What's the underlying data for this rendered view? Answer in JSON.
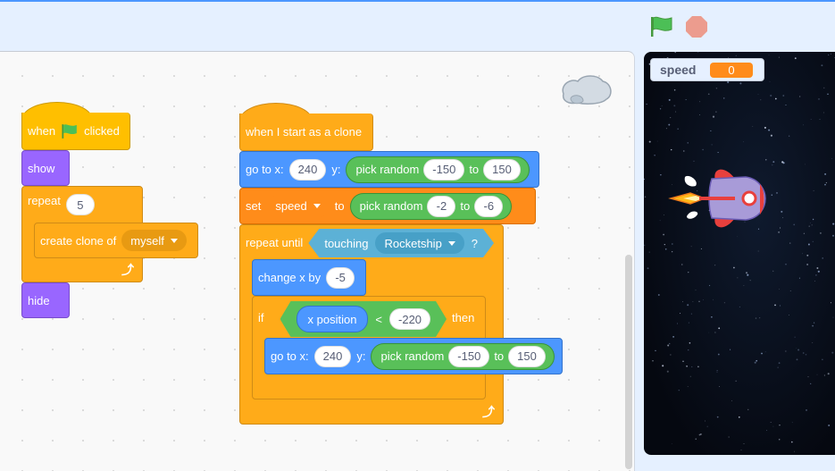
{
  "header": {
    "green_flag": "green-flag",
    "stop": "stop-sign"
  },
  "stage": {
    "monitor": {
      "label": "speed",
      "value": "0"
    },
    "sprite": "Rocketship"
  },
  "script1": {
    "hat": {
      "when": "when",
      "clicked": "clicked"
    },
    "show": "show",
    "repeat": {
      "label": "repeat",
      "count": "5"
    },
    "create_clone": {
      "label": "create clone of",
      "target": "myself"
    },
    "hide": "hide"
  },
  "script2": {
    "hat": "when I start as a clone",
    "goto1": {
      "label": "go to x:",
      "x": "240",
      "y_label": "y:",
      "pick": "pick random",
      "from": "-150",
      "to_label": "to",
      "to": "150"
    },
    "set": {
      "label": "set",
      "var": "speed",
      "to_label": "to",
      "pick": "pick random",
      "from": "-2",
      "to_sep": "to",
      "to": "-6"
    },
    "repeat_until": {
      "label": "repeat until",
      "touching": "touching",
      "target": "Rocketship",
      "q": "?"
    },
    "change_x": {
      "label": "change x by",
      "value": "-5"
    },
    "if": {
      "label": "if",
      "reporter": "x position",
      "op": "<",
      "value": "-220",
      "then": "then"
    },
    "goto2": {
      "label": "go to x:",
      "x": "240",
      "y_label": "y:",
      "pick": "pick random",
      "from": "-150",
      "to_label": "to",
      "to": "150"
    }
  }
}
